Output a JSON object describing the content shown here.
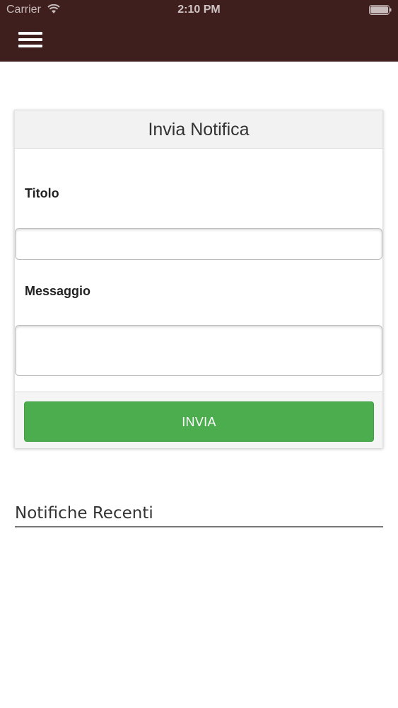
{
  "status_bar": {
    "carrier": "Carrier",
    "time": "2:10 PM"
  },
  "header": {
    "menu_icon": "hamburger-menu-icon",
    "background_color": "#3f1e1e"
  },
  "form": {
    "title": "Invia Notifica",
    "title_label": "Titolo",
    "title_value": "",
    "message_label": "Messaggio",
    "message_value": "",
    "submit_label": "INVIA",
    "submit_color": "#4cad4e"
  },
  "recent": {
    "heading": "Notifiche Recenti"
  }
}
